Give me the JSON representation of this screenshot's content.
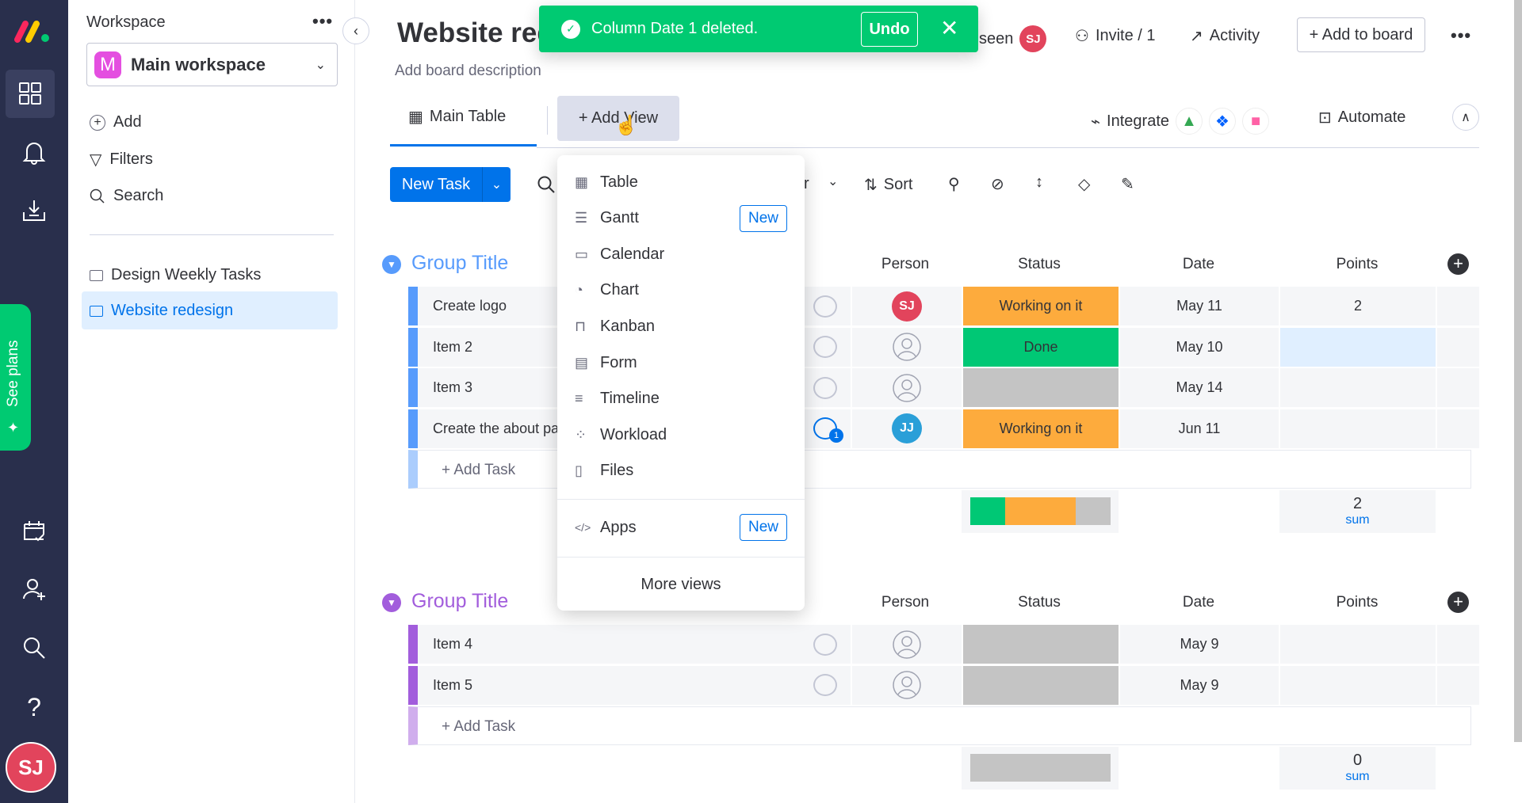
{
  "nav": {
    "user_initials": "SJ",
    "see_plans": "See plans",
    "icons": [
      "monday-logo",
      "grid-icon",
      "bell-icon",
      "download-icon",
      "calendar-check-icon",
      "person-add-icon",
      "search-icon",
      "help-icon"
    ]
  },
  "sidebar": {
    "title": "Workspace",
    "workspace": "Main workspace",
    "workspace_initial": "M",
    "add": "Add",
    "filters": "Filters",
    "search": "Search",
    "boards": [
      {
        "label": "Design Weekly Tasks"
      },
      {
        "label": "Website redesign"
      }
    ]
  },
  "board": {
    "title": "Website red",
    "description": "Add board description",
    "seen": "seen",
    "seen_initials": "SJ",
    "invite": "Invite / 1",
    "activity": "Activity",
    "add_to_board": "+ Add to board"
  },
  "toast": {
    "message": "Column Date 1 deleted.",
    "undo": "Undo",
    "color": "#00ca72"
  },
  "tabs": {
    "main_table": "Main Table",
    "add_view": "+ Add View",
    "integrate": "Integrate",
    "automate": "Automate"
  },
  "toolbar": {
    "new_task": "New Task",
    "partial": "r",
    "sort": "Sort"
  },
  "view_menu": {
    "items": [
      {
        "label": "Table",
        "icon": "table-icon"
      },
      {
        "label": "Gantt",
        "icon": "gantt-icon",
        "badge": "New"
      },
      {
        "label": "Calendar",
        "icon": "calendar-icon"
      },
      {
        "label": "Chart",
        "icon": "chart-icon"
      },
      {
        "label": "Kanban",
        "icon": "kanban-icon"
      },
      {
        "label": "Form",
        "icon": "form-icon"
      },
      {
        "label": "Timeline",
        "icon": "timeline-icon"
      },
      {
        "label": "Workload",
        "icon": "workload-icon"
      },
      {
        "label": "Files",
        "icon": "files-icon"
      }
    ],
    "apps": "Apps",
    "apps_badge": "New",
    "more": "More views"
  },
  "columns": {
    "person": "Person",
    "status": "Status",
    "date": "Date",
    "points": "Points"
  },
  "colors": {
    "working": "#fdab3d",
    "done": "#00c875",
    "empty": "#c4c4c4"
  },
  "groups": [
    {
      "title": "Group Title",
      "color": "#579bfc",
      "add_task": "+ Add Task",
      "sum_value": "2",
      "sum_label": "sum",
      "status_summary": {
        "done": 0.25,
        "working": 0.5,
        "empty": 0.25
      },
      "rows": [
        {
          "name": "Create logo",
          "person": "SJ",
          "person_color": "#e2445c",
          "status": "Working on it",
          "status_key": "working",
          "date": "May 11",
          "points": "2"
        },
        {
          "name": "Item 2",
          "person": "",
          "status": "Done",
          "status_key": "done",
          "date": "May 10",
          "points": ""
        },
        {
          "name": "Item 3",
          "person": "",
          "status": "",
          "status_key": "empty",
          "date": "May 14",
          "points": ""
        },
        {
          "name": "Create the about pa",
          "person": "JJ",
          "person_color": "#2a9fd8",
          "status": "Working on it",
          "status_key": "working",
          "date": "Jun 11",
          "points": "",
          "updates": "1"
        }
      ]
    },
    {
      "title": "Group Title",
      "color": "#a25ddc",
      "add_task": "+ Add Task",
      "sum_value": "0",
      "sum_label": "sum",
      "status_summary": {
        "done": 0,
        "working": 0,
        "empty": 1
      },
      "rows": [
        {
          "name": "Item 4",
          "person": "",
          "status": "",
          "status_key": "empty",
          "date": "May 9",
          "points": ""
        },
        {
          "name": "Item 5",
          "person": "",
          "status": "",
          "status_key": "empty",
          "date": "May 9",
          "points": ""
        }
      ]
    }
  ]
}
